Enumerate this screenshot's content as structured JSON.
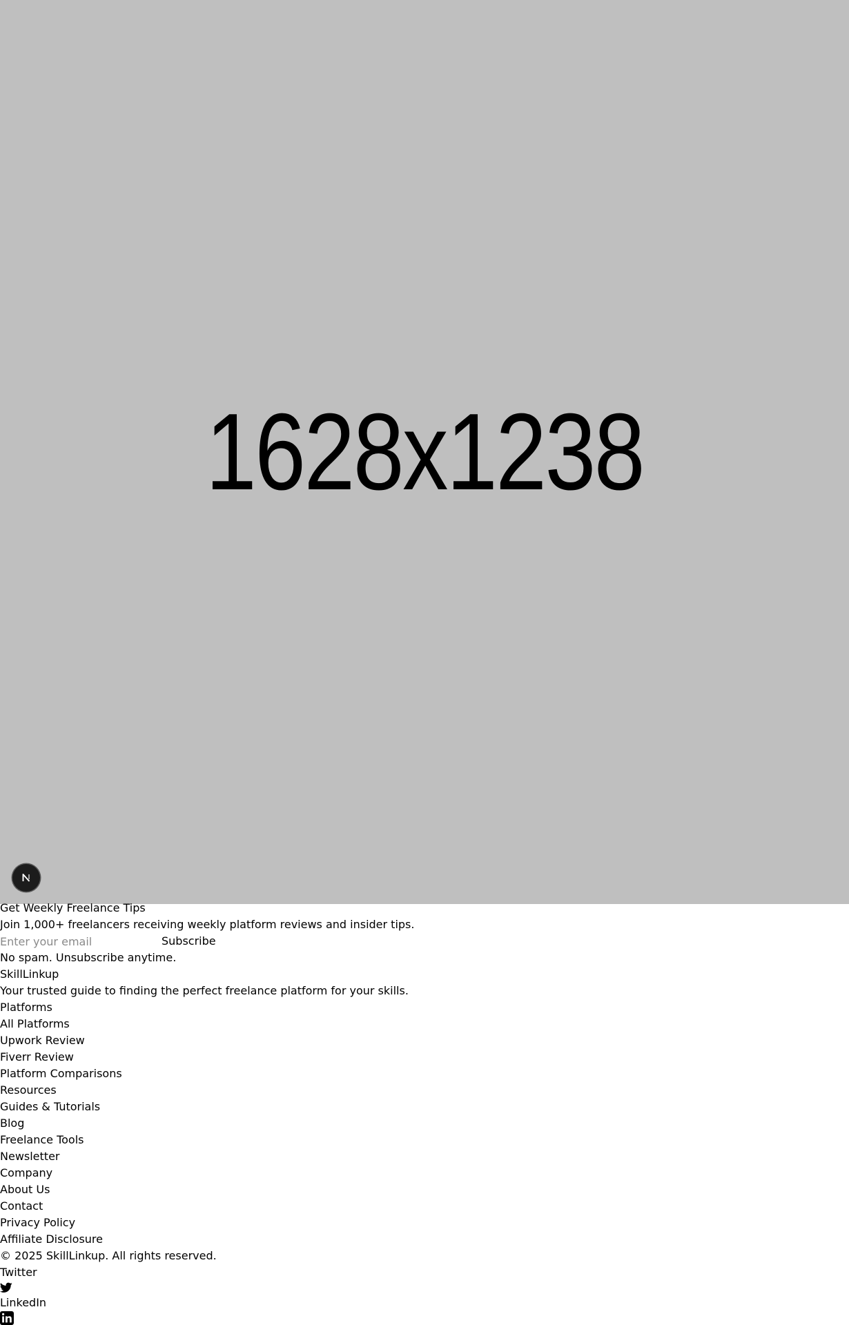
{
  "hero": {
    "placeholder_text": "1628x1238",
    "background_color": "#bfbfbf"
  },
  "dev_badge": {
    "icon": "nextjs-logo-icon",
    "label": "N"
  },
  "newsletter": {
    "title": "Get Weekly Freelance Tips",
    "description": "Join 1,000+ freelancers receiving weekly platform reviews and insider tips.",
    "email_placeholder": "Enter your email",
    "email_value": "",
    "subscribe_label": "Subscribe",
    "disclaimer": "No spam. Unsubscribe anytime."
  },
  "brand": {
    "name": "SkillLinkup",
    "tagline": "Your trusted guide to finding the perfect freelance platform for your skills."
  },
  "footer_sections": [
    {
      "heading": "Platforms",
      "links": [
        "All Platforms",
        "Upwork Review",
        "Fiverr Review",
        "Platform Comparisons"
      ]
    },
    {
      "heading": "Resources",
      "links": [
        "Guides & Tutorials",
        "Blog",
        "Freelance Tools",
        "Newsletter"
      ]
    },
    {
      "heading": "Company",
      "links": [
        "About Us",
        "Contact",
        "Privacy Policy",
        "Affiliate Disclosure"
      ]
    }
  ],
  "copyright": "© 2025 SkillLinkup. All rights reserved.",
  "social": [
    {
      "label": "Twitter",
      "icon": "twitter-icon"
    },
    {
      "label": "LinkedIn",
      "icon": "linkedin-icon"
    }
  ]
}
